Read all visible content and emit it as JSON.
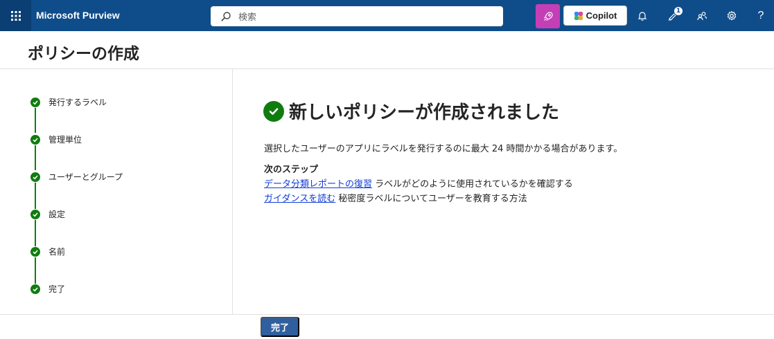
{
  "topbar": {
    "app_name": "Microsoft Purview",
    "search_placeholder": "検索",
    "copilot_label": "Copilot",
    "notification_count": "1",
    "help_label": "?"
  },
  "page": {
    "title": "ポリシーの作成"
  },
  "stepper": {
    "steps": [
      {
        "label": "発行するラベル",
        "status": "completed"
      },
      {
        "label": "管理単位",
        "status": "completed"
      },
      {
        "label": "ユーザーとグループ",
        "status": "completed"
      },
      {
        "label": "設定",
        "status": "completed"
      },
      {
        "label": "名前",
        "status": "completed"
      },
      {
        "label": "完了",
        "status": "completed"
      }
    ]
  },
  "main": {
    "success_title": "新しいポリシーが作成されました",
    "description": "選択したユーザーのアプリにラベルを発行するのに最大 24 時間かかる場合があります。",
    "next_steps_title": "次のステップ",
    "next_steps": [
      {
        "link_text": "データ分類レポートの復習",
        "text": " ラベルがどのように使用されているかを確認する"
      },
      {
        "link_text": "ガイダンスを読む",
        "text": " 秘密度ラベルについてユーザーを教育する方法"
      }
    ]
  },
  "footer": {
    "done_label": "完了"
  },
  "colors": {
    "topbar_bg": "#0f4d8a",
    "success_green": "#107c10",
    "link_blue": "#0f3bd9",
    "primary_button": "#2f5f9e",
    "rocket_button": "#c43fb6"
  }
}
